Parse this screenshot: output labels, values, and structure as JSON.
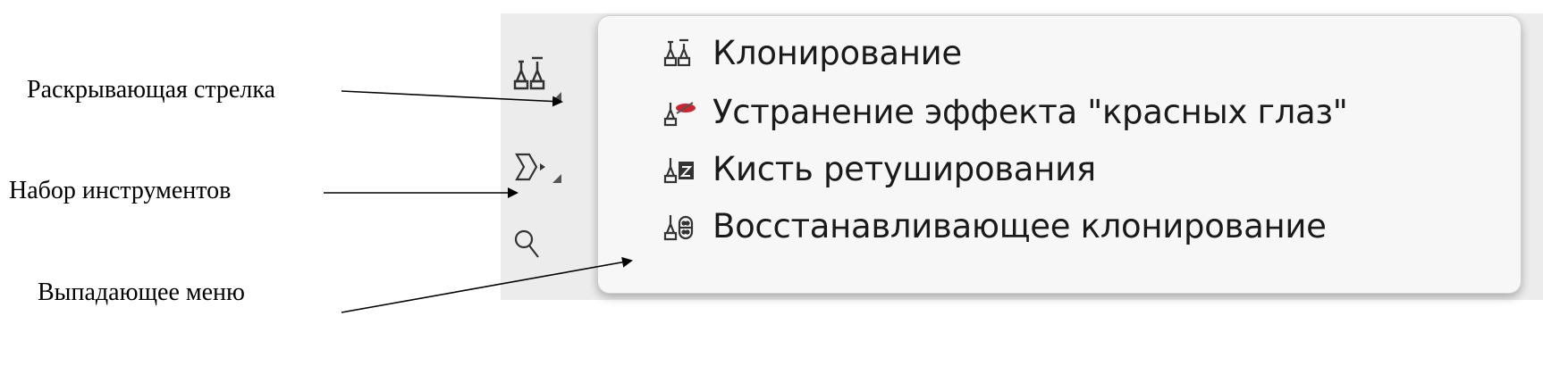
{
  "annotations": {
    "expand_arrow": "Раскрывающая стрелка",
    "tool_set": "Набор инструментов",
    "dropdown_menu": "Выпадающее меню"
  },
  "toolbar": {
    "tools": [
      {
        "icon": "clone-stamp-icon"
      },
      {
        "icon": "lasso-icon"
      },
      {
        "icon": "magnifier-icon"
      }
    ]
  },
  "menu": {
    "items": [
      {
        "label": "Клонирование",
        "icon": "clone-stamp-icon"
      },
      {
        "label": "Устранение эффекта \"красных глаз\"",
        "icon": "red-eye-icon"
      },
      {
        "label": "Кисть ретуширования",
        "icon": "retouch-brush-icon"
      },
      {
        "label": "Восстанавливающее клонирование",
        "icon": "healing-clone-icon"
      }
    ]
  },
  "colors": {
    "red_eye_accent": "#d0232f",
    "panel_bg": "#ececec",
    "menu_bg": "#f7f7f7"
  }
}
